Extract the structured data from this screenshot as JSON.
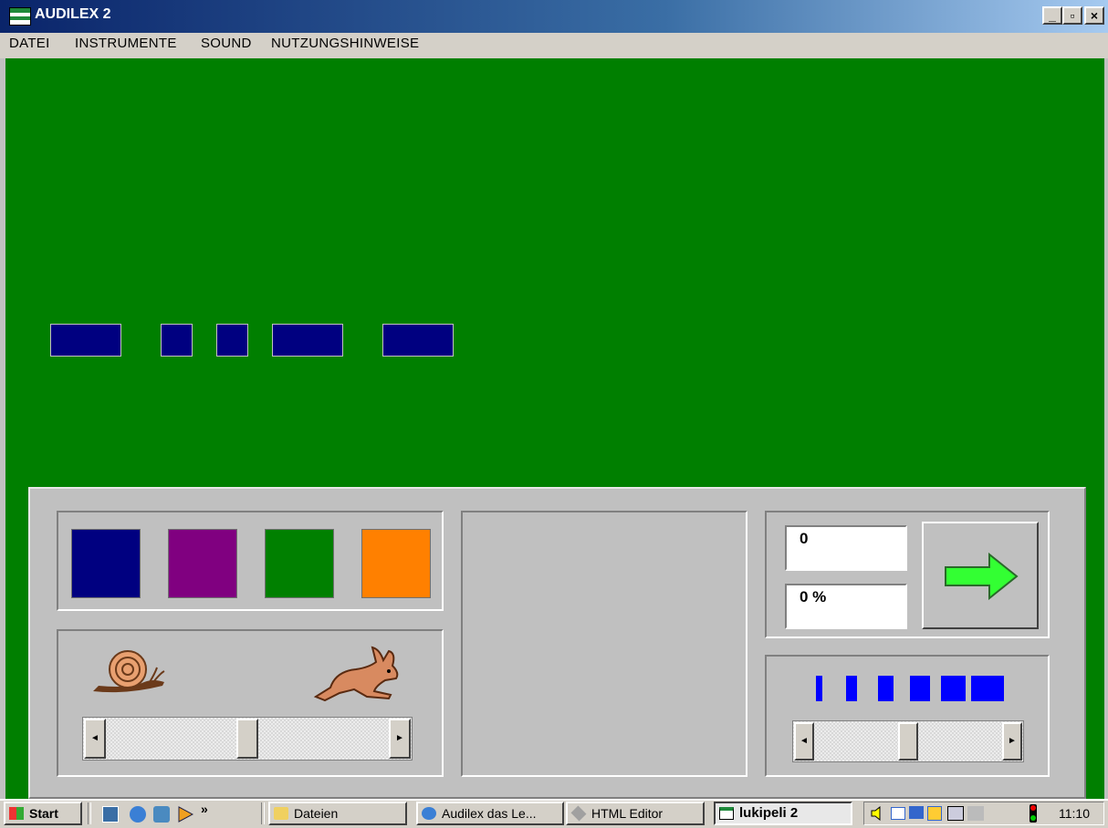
{
  "window": {
    "title": "AUDILEX 2",
    "minimize": "_",
    "restore": "▫",
    "close": "×"
  },
  "menu": [
    "DATEI",
    "INSTRUMENTE",
    "SOUND",
    "NUTZUNGSHINWEISE"
  ],
  "colors": {
    "swatches": [
      "#000080",
      "#800080",
      "#008000",
      "#ff8000"
    ],
    "background": "#007f00",
    "block": "#000080",
    "bars": "#0000ff"
  },
  "display": {
    "score": "0",
    "percent": "0 %"
  },
  "tempo_slider": {
    "left_arrow": "◄",
    "right_arrow": "►",
    "value": 0.5
  },
  "length_slider": {
    "left_arrow": "◄",
    "right_arrow": "►",
    "value": 0.5
  },
  "icons": {
    "snail": "snail-icon",
    "rabbit": "rabbit-icon",
    "next": "arrow-right-icon"
  },
  "taskbar": {
    "start": "Start",
    "chevron": "»",
    "tasks": [
      "Dateien",
      "Audilex das Le...",
      "HTML Editor",
      "lukipeli 2"
    ],
    "clock": "11:10"
  }
}
